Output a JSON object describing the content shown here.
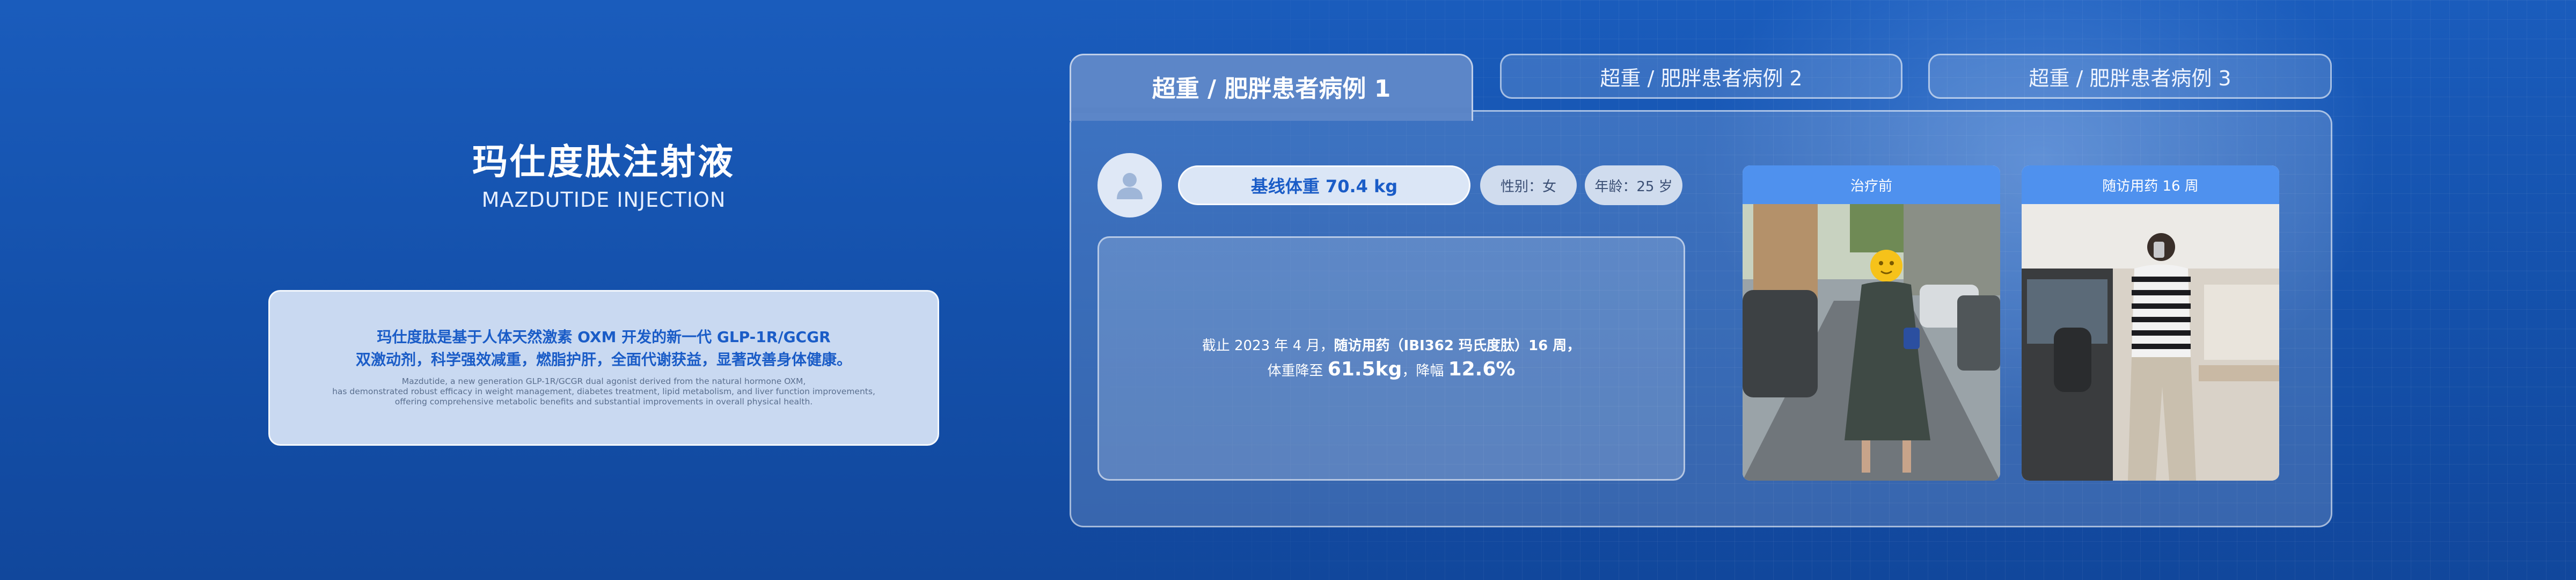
{
  "product": {
    "title_zh": "玛仕度肽注射液",
    "title_en": "MAZDUTIDE INJECTION",
    "desc_zh_line1": "玛仕度肽是基于人体天然激素 OXM 开发的新一代 GLP-1R/GCGR",
    "desc_zh_line2": "双激动剂，科学强效减重，燃脂护肝，全面代谢获益，显著改善身体健康。",
    "desc_en_line1": "Mazdutide, a new generation GLP-1R/GCGR dual agonist derived from the natural hormone OXM,",
    "desc_en_line2": "has demonstrated robust efficacy in weight management, diabetes treatment, lipid metabolism, and liver function improvements,",
    "desc_en_line3": "offering comprehensive metabolic benefits and substantial improvements in overall physical health."
  },
  "tabs": [
    {
      "label": "超重 / 肥胖患者病例 1",
      "active": true
    },
    {
      "label": "超重 / 肥胖患者病例 2",
      "active": false
    },
    {
      "label": "超重 / 肥胖患者病例 3",
      "active": false
    }
  ],
  "case": {
    "baseline_weight": "基线体重 70.4 kg",
    "gender": "性别：女",
    "age": "年龄：25 岁",
    "note_prefix": "截止 2023 年 4 月，",
    "note_bold": "随访用药（IBI362 玛氏度肽）16 周，",
    "note_line2_a": "体重降至 ",
    "note_weight": "61.5kg",
    "note_line2_b": "，降幅 ",
    "note_percent": "12.6%"
  },
  "photos": [
    {
      "label": "治疗前"
    },
    {
      "label": "随访用药 16 周"
    }
  ],
  "icons": {
    "avatar": "user-icon"
  },
  "colors": {
    "background": "#1656b4",
    "accent": "#1a5cc7",
    "photo_header": "#4f91ee"
  }
}
